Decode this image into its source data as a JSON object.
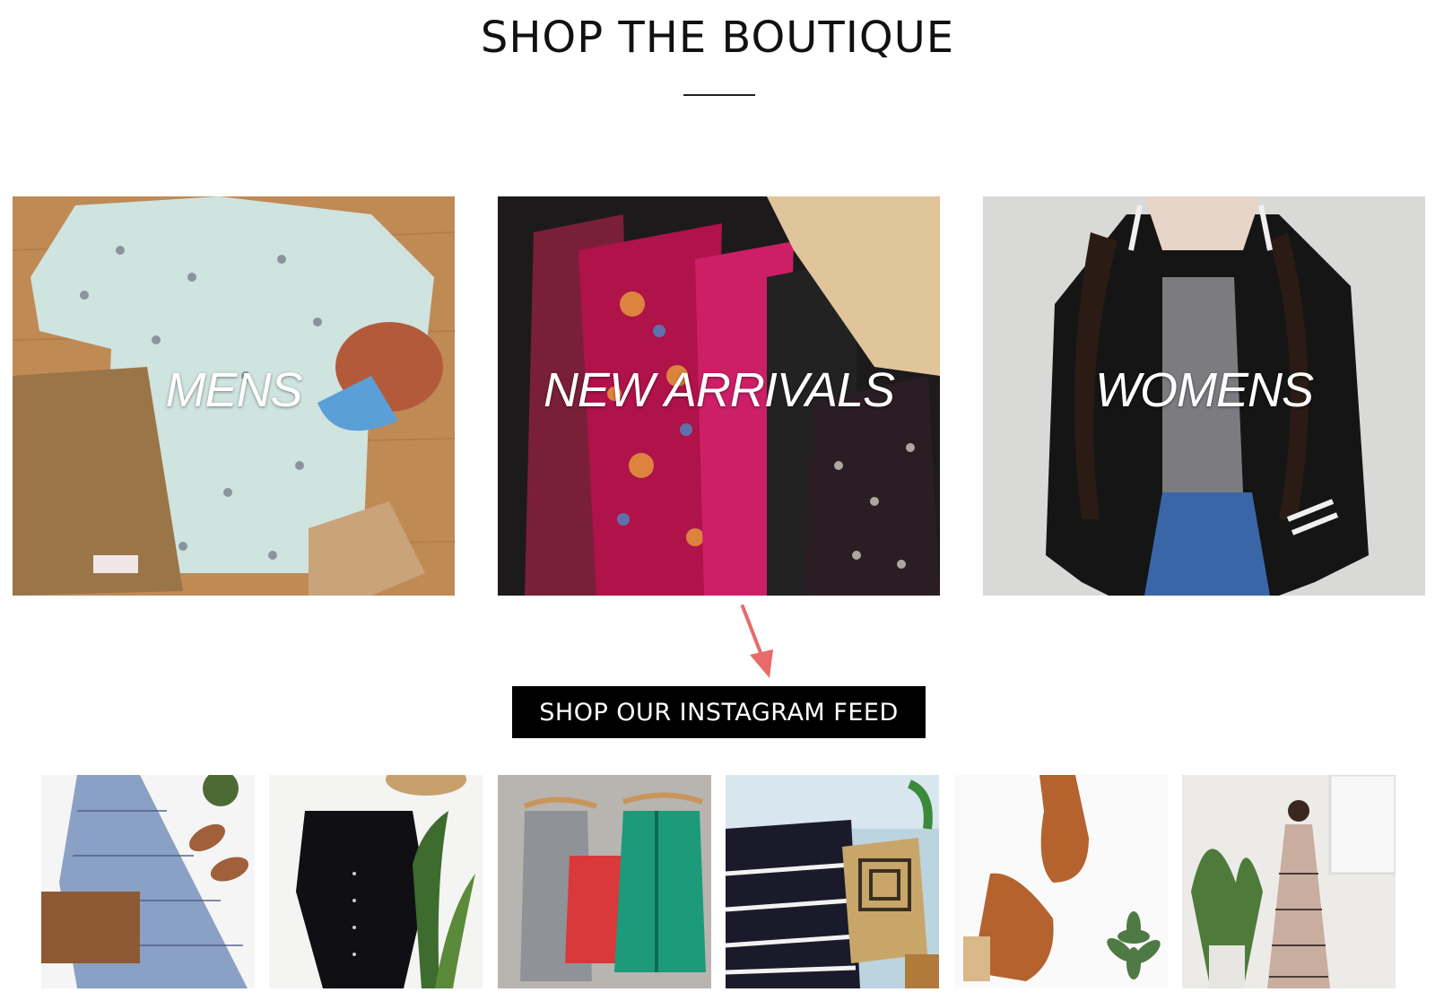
{
  "header": {
    "title": "SHOP THE BOUTIQUE"
  },
  "categories": [
    {
      "label": "MENS"
    },
    {
      "label": "NEW ARRIVALS"
    },
    {
      "label": "WOMENS"
    }
  ],
  "instagram": {
    "button_label": "SHOP OUR INSTAGRAM FEED"
  },
  "colors": {
    "accent_arrow": "#e86a6a",
    "button_bg": "#000000",
    "button_text": "#ffffff"
  }
}
